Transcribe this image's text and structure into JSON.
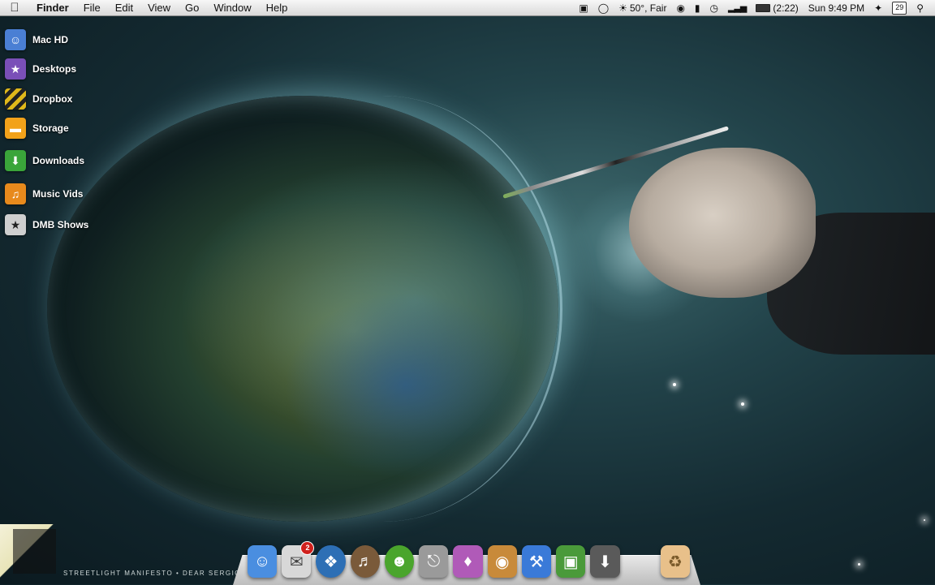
{
  "menubar": {
    "apple_icon": "apple-logo",
    "app_name": "Finder",
    "menus": [
      "File",
      "Edit",
      "View",
      "Go",
      "Window",
      "Help"
    ],
    "status": {
      "weather": "50°, Fair",
      "battery_time": "(2:22)",
      "clock": "Sun 9:49 PM",
      "calendar_day": "29"
    }
  },
  "desktop_icons": [
    {
      "label": "Mac HD",
      "icon": "finder-drive-icon",
      "color": "#4a7fd4"
    },
    {
      "label": "Desktops",
      "icon": "desktops-folder-icon",
      "color": "#7a4fb8"
    },
    {
      "label": "Dropbox",
      "icon": "dropbox-striped-icon",
      "color": "#e0b81a"
    },
    {
      "label": "Storage",
      "icon": "storage-drive-icon",
      "color": "#f2a21a"
    },
    {
      "label": "Downloads",
      "icon": "download-arrow-icon",
      "color": "#3aa53a"
    },
    {
      "label": "Music Vids",
      "icon": "music-note-icon",
      "color": "#e88a1c"
    },
    {
      "label": "DMB Shows",
      "icon": "dmb-star-icon",
      "color": "#cfcfcf"
    }
  ],
  "dock": {
    "mail_badge": "2",
    "items": [
      {
        "name": "finder",
        "icon": "finder-face-icon",
        "color": "#4a8ee0"
      },
      {
        "name": "mail",
        "icon": "mail-stamp-icon",
        "color": "#d8d8d8"
      },
      {
        "name": "safari",
        "icon": "compass-icon",
        "color": "#2d6fb5"
      },
      {
        "name": "itunes",
        "icon": "music-disc-icon",
        "color": "#7a5a3a"
      },
      {
        "name": "adium",
        "icon": "frog-icon",
        "color": "#4aa52c"
      },
      {
        "name": "system-preferences",
        "icon": "joystick-icon",
        "color": "#9a9a9a"
      },
      {
        "name": "app-ice-cream",
        "icon": "popsicle-icon",
        "color": "#b05ab8"
      },
      {
        "name": "photos",
        "icon": "camera-photos-icon",
        "color": "#c88a3a"
      },
      {
        "name": "xcode",
        "icon": "blue-tool-icon",
        "color": "#3a7ad8"
      },
      {
        "name": "preview",
        "icon": "picture-frame-icon",
        "color": "#4a9a3a"
      },
      {
        "name": "installer",
        "icon": "download-box-icon",
        "color": "#5a5a5a"
      },
      {
        "name": "trash",
        "icon": "recycle-box-icon",
        "color": "#e8c08a"
      }
    ]
  },
  "caption": "STREETLIGHT MANIFESTO • DEAR SERGIO"
}
